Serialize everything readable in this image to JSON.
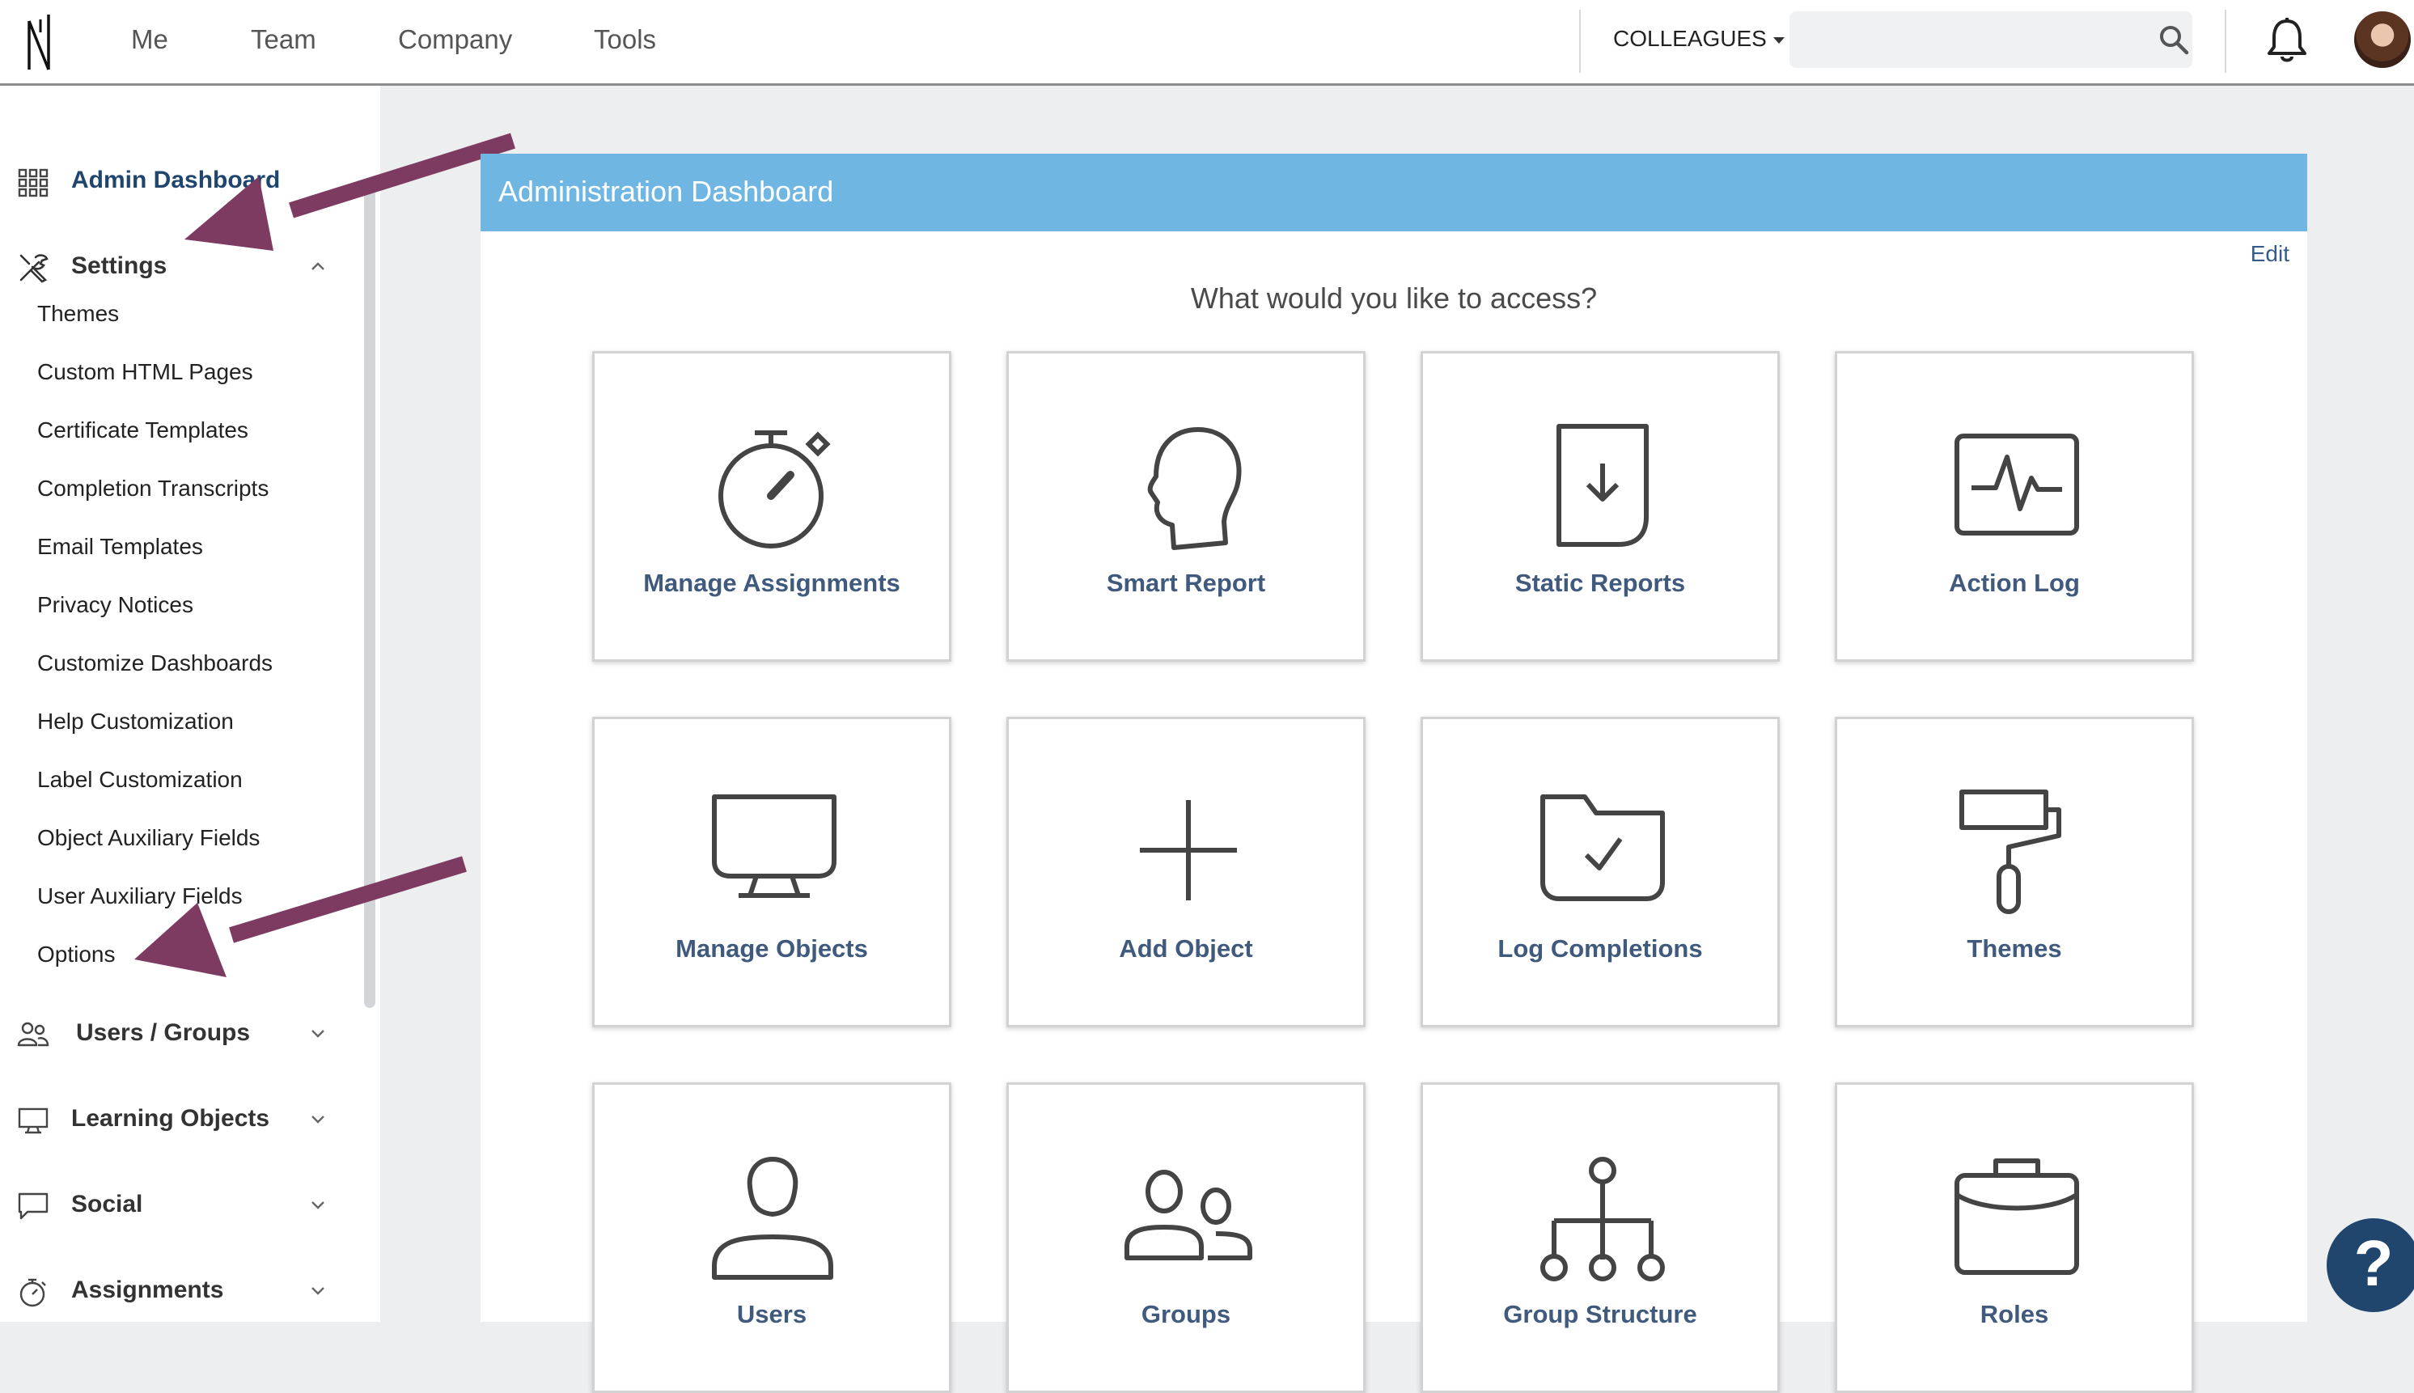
{
  "topnav": {
    "items": [
      "Me",
      "Team",
      "Company",
      "Tools"
    ],
    "colleagues": "COLLEAGUES",
    "search_placeholder": ""
  },
  "sidebar": {
    "admin_dashboard": "Admin Dashboard",
    "settings": "Settings",
    "settings_items": [
      "Themes",
      "Custom HTML Pages",
      "Certificate Templates",
      "Completion Transcripts",
      "Email Templates",
      "Privacy Notices",
      "Customize Dashboards",
      "Help Customization",
      "Label Customization",
      "Object Auxiliary Fields",
      "User Auxiliary Fields",
      "Options"
    ],
    "users_groups": "Users / Groups",
    "learning_objects": "Learning Objects",
    "social": "Social",
    "assignments": "Assignments"
  },
  "main": {
    "title": "Administration Dashboard",
    "edit": "Edit",
    "prompt": "What would you like to access?",
    "tiles": [
      {
        "label": "Manage Assignments",
        "icon": "stopwatch-icon"
      },
      {
        "label": "Smart Report",
        "icon": "head-profile-icon"
      },
      {
        "label": "Static Reports",
        "icon": "download-document-icon"
      },
      {
        "label": "Action Log",
        "icon": "activity-pulse-icon"
      },
      {
        "label": "Manage Objects",
        "icon": "monitor-icon"
      },
      {
        "label": "Add Object",
        "icon": "plus-icon"
      },
      {
        "label": "Log Completions",
        "icon": "folder-check-icon"
      },
      {
        "label": "Themes",
        "icon": "paint-roller-icon"
      },
      {
        "label": "Users",
        "icon": "user-icon"
      },
      {
        "label": "Groups",
        "icon": "users-group-icon"
      },
      {
        "label": "Group Structure",
        "icon": "hierarchy-icon"
      },
      {
        "label": "Roles",
        "icon": "briefcase-icon"
      }
    ]
  },
  "help": {
    "label": "?"
  },
  "colors": {
    "header_blue": "#6fb6e2",
    "tile_label": "#405a7e",
    "annotation_arrow": "#7d3b62",
    "help_button": "#21466e"
  }
}
